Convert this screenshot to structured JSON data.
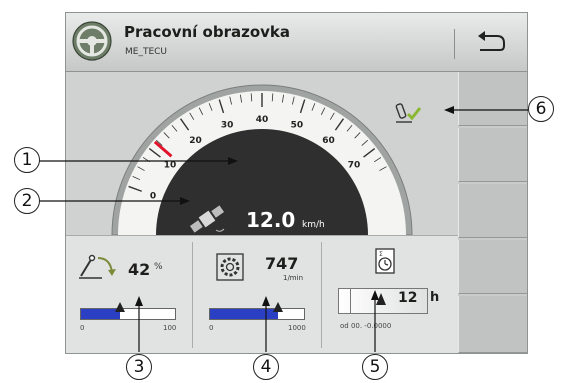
{
  "header": {
    "title": "Pracovní obrazovka",
    "subtitle": "ME_TECU",
    "logo_icon": "tractor-steering-wheel-icon",
    "back_icon": "back-arrow-icon"
  },
  "gauge": {
    "type": "speedometer",
    "scale_labels": [
      "0",
      "10",
      "20",
      "30",
      "40",
      "50",
      "60",
      "70"
    ],
    "speed_value": "12.0",
    "speed_unit": "km/h",
    "speed_source_icon": "gps-satellite-icon",
    "red_marker_at": 12
  },
  "status": {
    "icon": "linkage-confirmed-icon"
  },
  "panels": {
    "hitch": {
      "icon": "hitch-position-icon",
      "value": "42",
      "unit": "%",
      "min_label": "0",
      "max_label": "100",
      "fill_fraction": 0.42
    },
    "pto": {
      "icon": "pto-gear-icon",
      "value": "747",
      "unit": "1/min",
      "min_label": "0",
      "max_label": "1000",
      "fill_fraction": 0.72
    },
    "hours": {
      "icon": "timer-icon",
      "value": "12",
      "unit": "h",
      "since_label": "od 00. -0.0000"
    }
  },
  "callouts": [
    "1",
    "2",
    "3",
    "4",
    "5",
    "6"
  ],
  "colors": {
    "bar_fill": "#2b3fc5",
    "check_green": "#8ab832",
    "needle_red": "#e0132a",
    "gauge_dark": "#2f2f2f"
  }
}
